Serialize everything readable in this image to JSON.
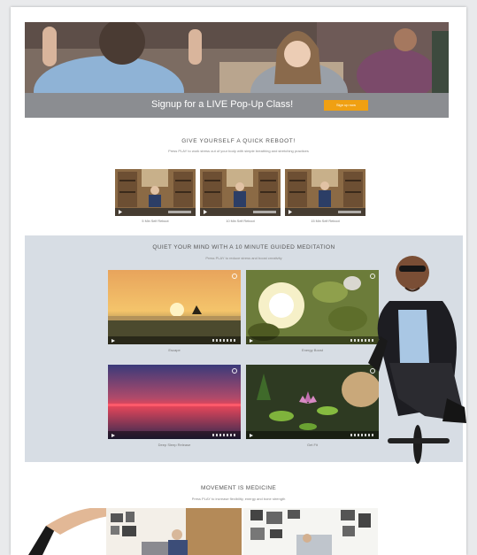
{
  "hero": {
    "banner_text": "Signup for a LIVE Pop-Up Class!",
    "button_label": "Sign up now"
  },
  "reboot": {
    "title": "GIVE YOURSELF A QUICK REBOOT!",
    "subtitle": "Press PLAY to work stress out of your body with simple breathing and stretching practices",
    "videos": [
      {
        "caption": "5 Min Self Reboot"
      },
      {
        "caption": "10 Min Self Reboot"
      },
      {
        "caption": "15 Min Self Reboot"
      }
    ]
  },
  "meditation": {
    "title": "QUIET YOUR MIND WITH A 10 MINUTE GUIDED MEDITATION",
    "subtitle": "Press PLAY to reduce stress and boost creativity",
    "videos": [
      {
        "caption": "Escape"
      },
      {
        "caption": "Energy Boost"
      },
      {
        "caption": "Deep Sleep Release"
      },
      {
        "caption": "Get Fit"
      }
    ]
  },
  "movement": {
    "title": "MOVEMENT IS MEDICINE",
    "subtitle": "Press PLAY to increase flexibility, energy and bone strength"
  },
  "colors": {
    "accent": "#f0a012",
    "banner_bar": "#8b8d91",
    "meditation_bg": "#d7dde4"
  }
}
